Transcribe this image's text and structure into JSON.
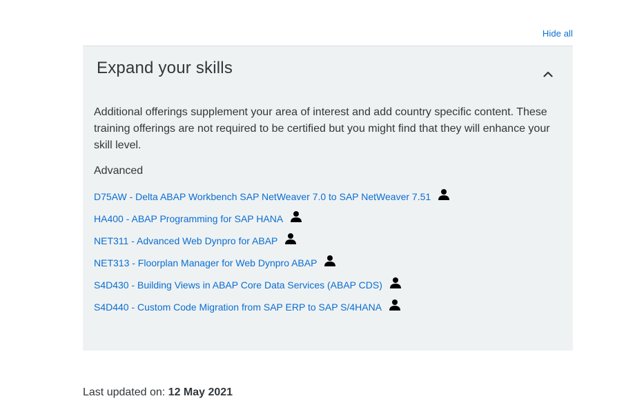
{
  "header": {
    "hide_all_label": "Hide all"
  },
  "panel": {
    "title": "Expand your skills",
    "description": "Additional offerings supplement your area of interest and add country specific content. These training offerings are not required to be certified but you might find that they will enhance your skill level.",
    "level_label": "Advanced",
    "collapse_icon": "chevron-up-icon",
    "course_icon": "person-icon",
    "courses": [
      {
        "label": "D75AW - Delta ABAP Workbench SAP NetWeaver 7.0 to SAP NetWeaver 7.51"
      },
      {
        "label": "HA400 - ABAP Programming for SAP HANA"
      },
      {
        "label": "NET311 - Advanced Web Dynpro for ABAP"
      },
      {
        "label": "NET313 - Floorplan Manager for Web Dynpro ABAP"
      },
      {
        "label": "S4D430 - Building Views in ABAP Core Data Services (ABAP CDS)"
      },
      {
        "label": "S4D440 - Custom Code Migration from SAP ERP to SAP S/4HANA"
      }
    ]
  },
  "footer": {
    "last_updated_label": "Last updated on:",
    "last_updated_date": "12 May 2021"
  },
  "colors": {
    "link": "#0a6ed1",
    "panel_background": "#eff2f3",
    "text": "#32363a"
  }
}
